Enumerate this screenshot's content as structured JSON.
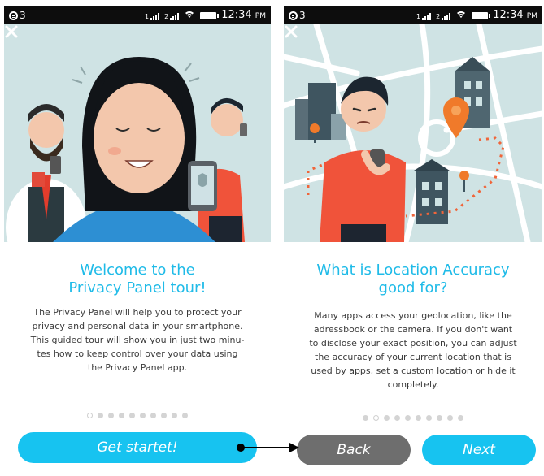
{
  "statusbar": {
    "notification_count": "3",
    "sim1": "1",
    "sim2": "2",
    "time": "12:34",
    "ampm": "PM"
  },
  "screen1": {
    "title_line1": "Welcome to the",
    "title_line2": "Privacy Panel tour!",
    "body_lines": [
      "The Privacy Panel will help you to protect your",
      "privacy and personal data in your smartphone.",
      "This guided tour will show you in just two minu-",
      "tes how to keep control over your data using",
      "the Privacy Panel app."
    ],
    "dots_total": 10,
    "dots_active": 0,
    "button_label": "Get startet!"
  },
  "screen2": {
    "title_line1": "What is Location Accuracy",
    "title_line2": "good for?",
    "body_lines": [
      "Many apps access your geolocation, like the",
      "adressbook or the camera. If you don't want",
      "to disclose your exact position, you can adjust",
      "the accuracy of your current location that is",
      "used by apps, set a custom location or hide it",
      "completely."
    ],
    "dots_total": 10,
    "dots_active": 1,
    "back_label": "Back",
    "next_label": "Next"
  },
  "colors": {
    "accent": "#17c3f0",
    "title": "#1fbbe8",
    "back_button": "#6e6e6e",
    "hero_bg": "#cfe3e4"
  },
  "icons": [
    "notification-icon",
    "signal-icon",
    "wifi-icon",
    "battery-icon",
    "close-icon",
    "arrow-icon"
  ]
}
